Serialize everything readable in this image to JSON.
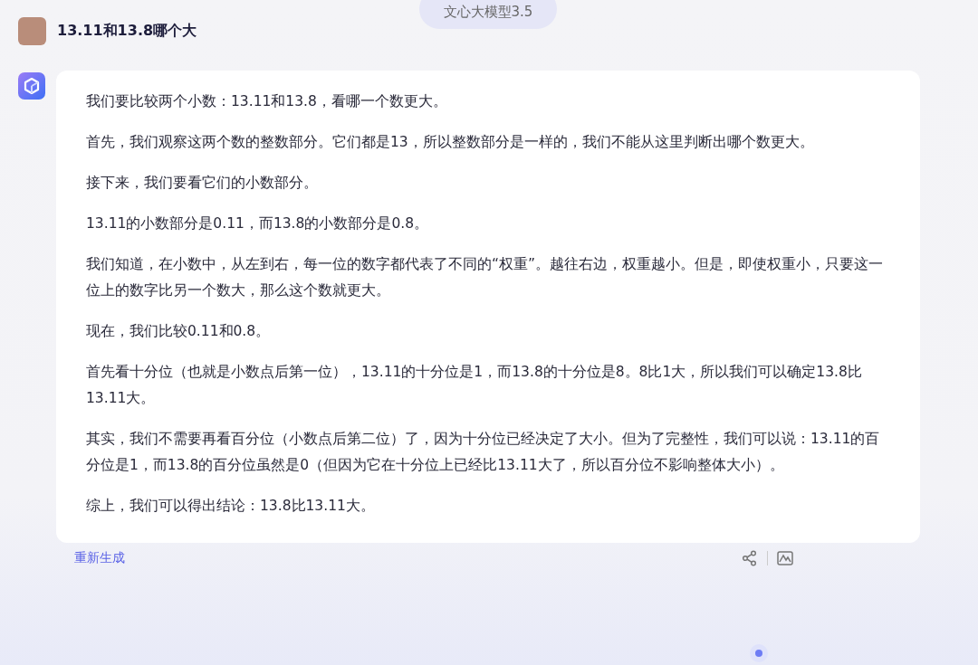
{
  "model_badge": "文心大模型3.5",
  "question": "13.11和13.8哪个大",
  "answer": [
    "我们要比较两个小数：13.11和13.8，看哪一个数更大。",
    "首先，我们观察这两个数的整数部分。它们都是13，所以整数部分是一样的，我们不能从这里判断出哪个数更大。",
    "接下来，我们要看它们的小数部分。",
    "13.11的小数部分是0.11，而13.8的小数部分是0.8。",
    "我们知道，在小数中，从左到右，每一位的数字都代表了不同的“权重”。越往右边，权重越小。但是，即使权重小，只要这一位上的数字比另一个数大，那么这个数就更大。",
    "现在，我们比较0.11和0.8。",
    "首先看十分位（也就是小数点后第一位），13.11的十分位是1，而13.8的十分位是8。8比1大，所以我们可以确定13.8比13.11大。",
    "其实，我们不需要再看百分位（小数点后第二位）了，因为十分位已经决定了大小。但为了完整性，我们可以说：13.11的百分位是1，而13.8的百分位虽然是0（但因为它在十分位上已经比13.11大了，所以百分位不影响整体大小）。",
    "综上，我们可以得出结论：13.8比13.11大。"
  ],
  "regenerate": "重新生成"
}
